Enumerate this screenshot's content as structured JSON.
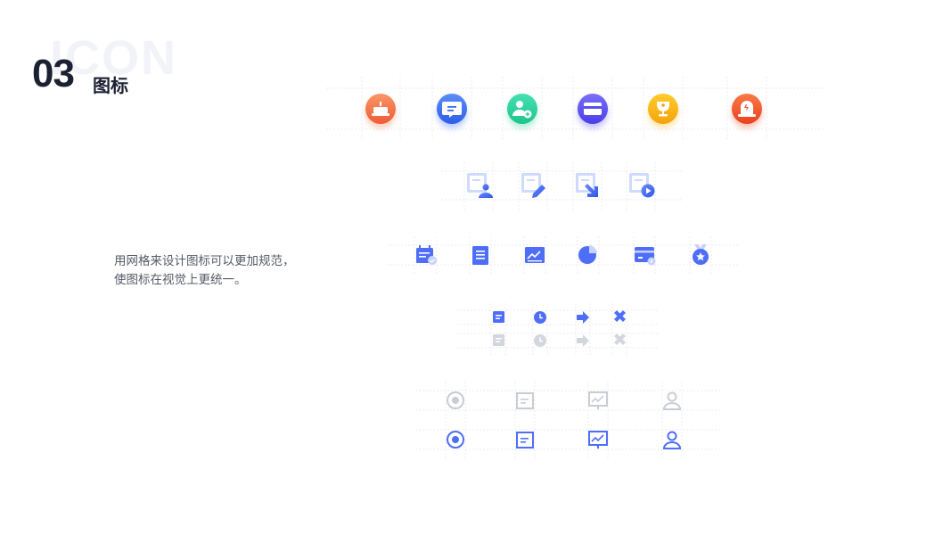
{
  "header": {
    "background_word": "ICON",
    "section_number": "03",
    "section_title": "图标"
  },
  "description": {
    "line1": "用网格来设计图标可以更加规范，",
    "line2": "使图标在视觉上更统一。"
  },
  "colors": {
    "primary_blue": "#4f6ef7",
    "muted_gray": "#c9ccd4",
    "grid_line": "#e4e6eb",
    "circle_icons": [
      "#f5774a",
      "#3a6cf0",
      "#2ecf9a",
      "#5b4ff0",
      "#f9b414",
      "#f2552c"
    ]
  },
  "icon_rows": {
    "circle_row": [
      "cake-icon",
      "chat-icon",
      "add-user-icon",
      "card-icon",
      "trophy-icon",
      "alarm-icon"
    ],
    "document_row": [
      "document-user-icon",
      "document-edit-icon",
      "document-download-icon",
      "document-play-icon"
    ],
    "office_row": [
      "calendar-check-icon",
      "clipboard-icon",
      "chart-board-icon",
      "pie-chart-icon",
      "wallet-icon",
      "medal-icon"
    ],
    "small_row": [
      "note-icon",
      "clock-icon",
      "arrow-right-icon",
      "close-icon"
    ],
    "outline_row": [
      "target-icon",
      "form-icon",
      "presentation-icon",
      "user-icon"
    ]
  }
}
